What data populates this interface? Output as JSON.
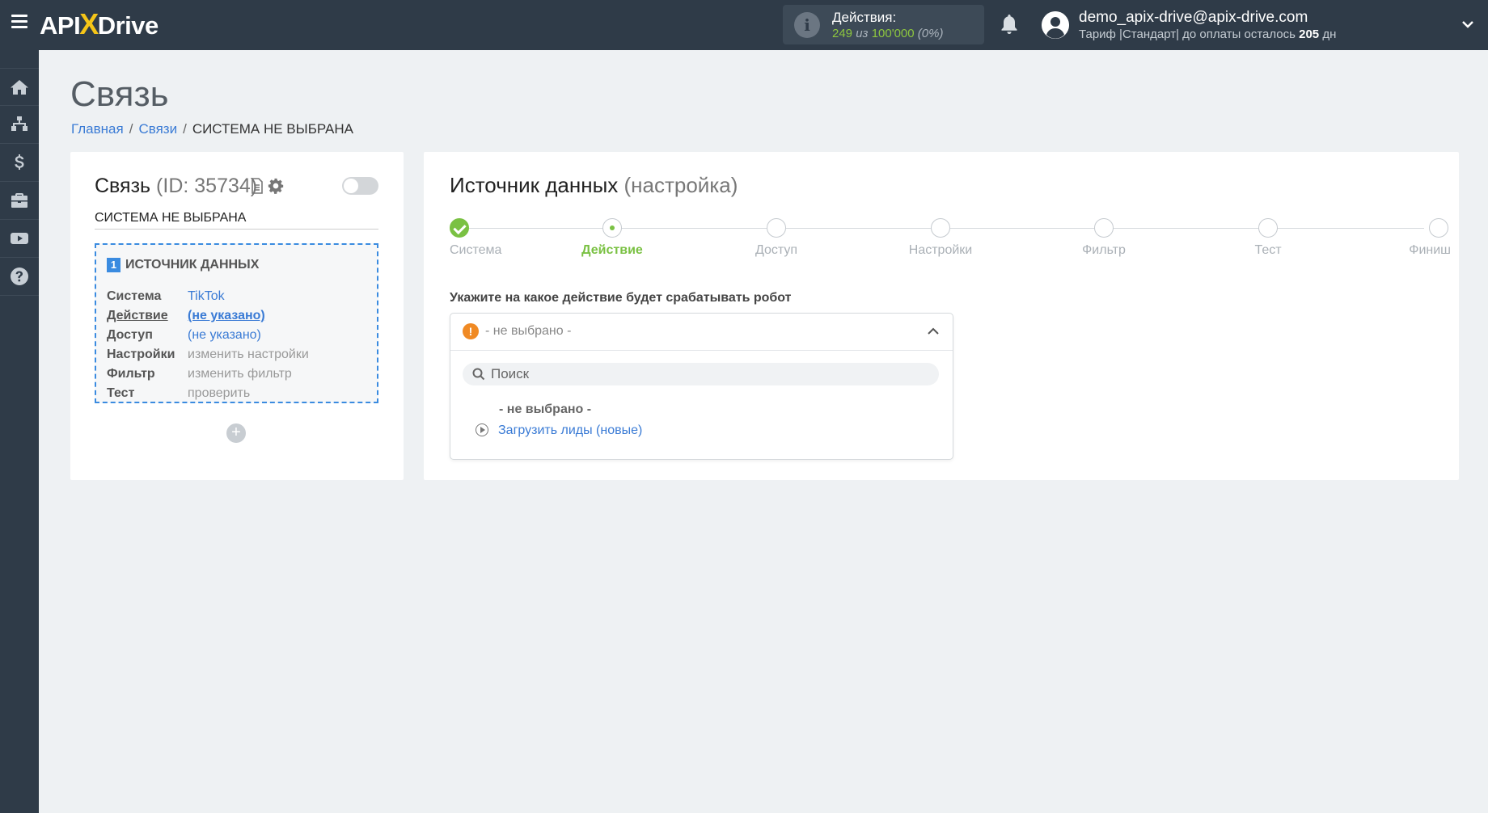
{
  "header": {
    "logo": {
      "part1": "API",
      "x": "X",
      "part2": "Drive"
    },
    "actions": {
      "label": "Действия:",
      "used": "249",
      "of_text": "из",
      "limit": "100'000",
      "percent": "(0%)"
    },
    "user": {
      "email": "demo_apix-drive@apix-drive.com",
      "plan_prefix": "Тариф |Стандарт| до оплаты осталось",
      "days": "205",
      "days_unit": "дн"
    }
  },
  "sidebar": {
    "items": [
      {
        "icon": "home-icon"
      },
      {
        "icon": "sitemap-icon"
      },
      {
        "icon": "dollar-icon"
      },
      {
        "icon": "briefcase-icon"
      },
      {
        "icon": "youtube-icon"
      },
      {
        "icon": "help-icon"
      }
    ]
  },
  "page": {
    "title": "Связь",
    "breadcrumb": {
      "home": "Главная",
      "links": "Связи",
      "current": "СИСТЕМА НЕ ВЫБРАНА"
    }
  },
  "connection": {
    "title": "Связь",
    "id_text": "(ID: 35734)",
    "name": "СИСТЕМА НЕ ВЫБРАНА",
    "source": {
      "number": "1",
      "heading": "ИСТОЧНИК ДАННЫХ",
      "rows": [
        {
          "key": "Система",
          "value": "TikTok"
        },
        {
          "key": "Действие",
          "value": "(не указано)"
        },
        {
          "key": "Доступ",
          "value": "(не указано)"
        },
        {
          "key": "Настройки",
          "value": "изменить настройки"
        },
        {
          "key": "Фильтр",
          "value": "изменить фильтр"
        },
        {
          "key": "Тест",
          "value": "проверить"
        }
      ]
    },
    "add_label": "+"
  },
  "source_settings": {
    "title": "Источник данных",
    "subtitle": "(настройка)",
    "steps": [
      "Система",
      "Действие",
      "Доступ",
      "Настройки",
      "Фильтр",
      "Тест",
      "Финиш"
    ],
    "current_step": 1,
    "action_prompt": "Укажите на какое действие будет срабатывать робот",
    "dropdown": {
      "selected": "- не выбрано -",
      "search_placeholder": "Поиск",
      "options": [
        "- не выбрано -",
        "Загрузить лиды (новые)"
      ]
    }
  },
  "colors": {
    "accent_green": "#7ac143",
    "link_blue": "#3a7bd5",
    "topbar": "#2f3b48",
    "warning": "#f08a24"
  }
}
